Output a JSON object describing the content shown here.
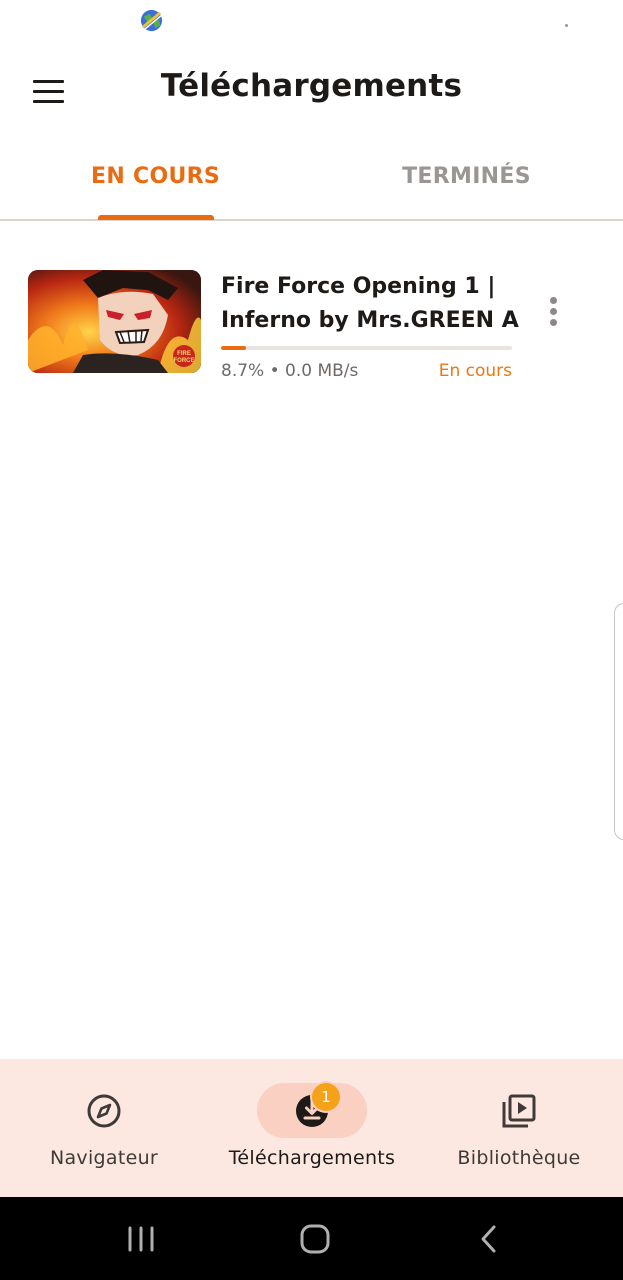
{
  "status_bar": {
    "app_icon": "globe-icon"
  },
  "app_bar": {
    "menu_icon": "hamburger-menu-icon",
    "title": "Téléchargements"
  },
  "tabs": [
    {
      "label": "EN COURS",
      "active": true
    },
    {
      "label": "TERMINÉS",
      "active": false
    }
  ],
  "downloads": [
    {
      "title_line1": "Fire Force Opening 1 |",
      "title_line2": "Inferno by Mrs.GREEN A...",
      "thumbnail": "fire-force-thumbnail",
      "progress_fraction": 0.087,
      "progress_text": "8.7% • 0.0 MB/s",
      "status": "En cours",
      "menu_icon": "more-vertical-icon"
    }
  ],
  "bottom_nav": {
    "items": [
      {
        "label": "Navigateur",
        "icon": "compass-icon",
        "active": false
      },
      {
        "label": "Téléchargements",
        "icon": "download-icon",
        "active": true,
        "badge": "1"
      },
      {
        "label": "Bibliothèque",
        "icon": "video-library-icon",
        "active": false
      }
    ]
  },
  "system_nav": {
    "recents_icon": "recents-icon",
    "home_icon": "home-icon",
    "back_icon": "back-icon"
  },
  "colors": {
    "accent": "#ea6b12",
    "inactive_tab": "#9b9593",
    "bottom_nav_bg": "#fce8e1",
    "active_pill": "#f9d0c2",
    "badge": "#f4a219",
    "status_text": "#e8780f"
  }
}
